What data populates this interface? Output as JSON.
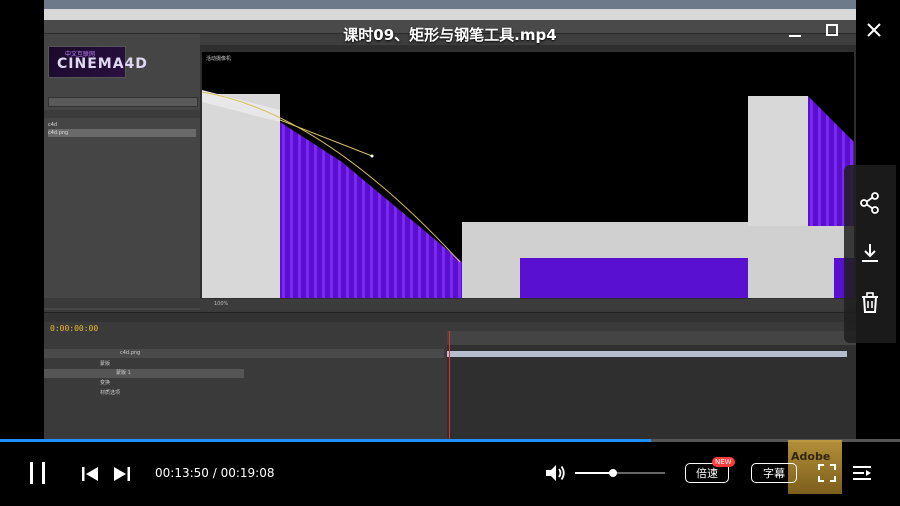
{
  "player": {
    "title": "课时09、矩形与钢笔工具.mp4",
    "current_time": "00:13:50",
    "separator": " / ",
    "total_time": "00:19:08",
    "progress": 0.723,
    "volume": 0.42,
    "speed_label": "倍速",
    "new_badge": "NEW",
    "subtitle_label": "字幕",
    "watermark_text": "Adobe",
    "accent_color": "#1e90ff"
  },
  "window_controls": {
    "minimize_icon": "minimize-icon",
    "maximize_icon": "maximize-icon",
    "close_icon": "close-icon"
  },
  "side_panel": {
    "items": [
      "share-icon",
      "download-icon",
      "delete-icon"
    ]
  },
  "video_frame": {
    "logo_text": "CINEMA4D",
    "logo_small": "中文互联网",
    "project_rows": [
      "c4d",
      "c4d.png"
    ],
    "timecode": "0:00:00:00",
    "layer_name": "c4d.png",
    "timeline_rows": [
      "蒙版",
      "蒙版 1",
      "变换",
      "材质选项"
    ],
    "comp_label": "活动摄像机",
    "zoom": "100%"
  }
}
